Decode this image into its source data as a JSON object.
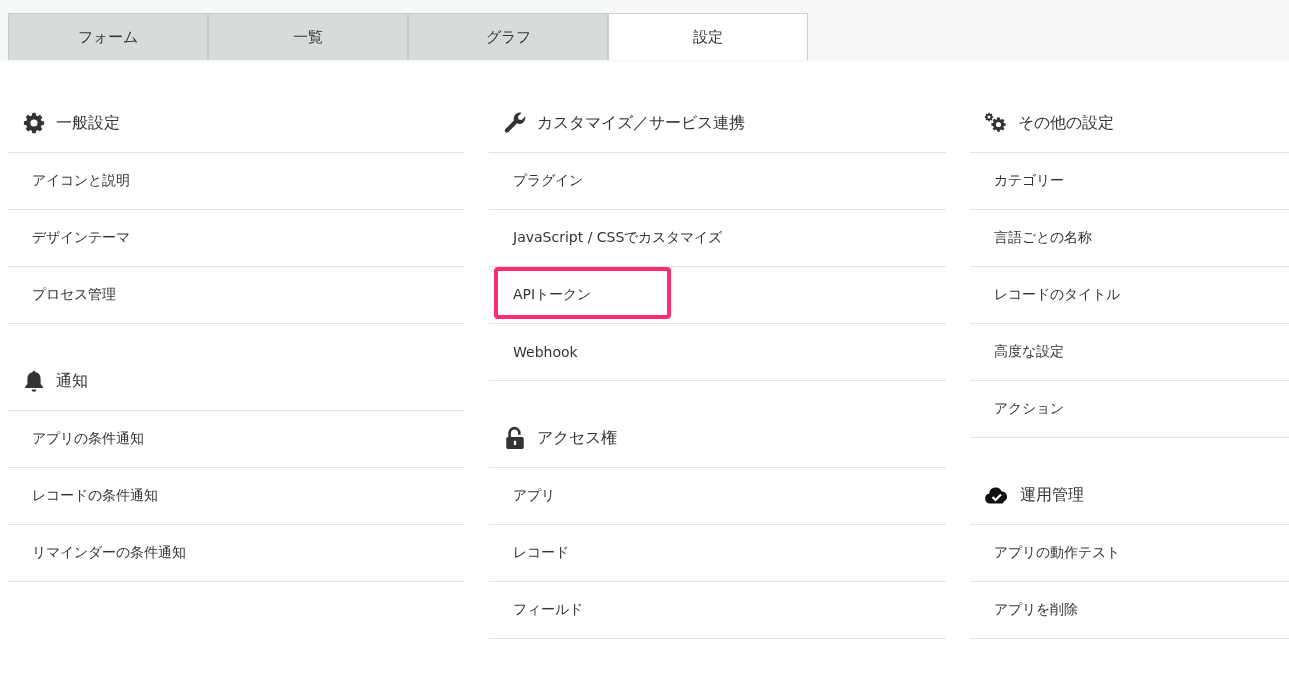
{
  "tabs": [
    {
      "label": "フォーム",
      "selected": false
    },
    {
      "label": "一覧",
      "selected": false
    },
    {
      "label": "グラフ",
      "selected": false
    },
    {
      "label": "設定",
      "selected": true
    }
  ],
  "columns": [
    {
      "sections": [
        {
          "kind": "gear",
          "title": "一般設定",
          "items": [
            {
              "label": "アイコンと説明",
              "highlighted": false
            },
            {
              "label": "デザインテーマ",
              "highlighted": false
            },
            {
              "label": "プロセス管理",
              "highlighted": false
            }
          ]
        },
        {
          "kind": "bell",
          "title": "通知",
          "items": [
            {
              "label": "アプリの条件通知",
              "highlighted": false
            },
            {
              "label": "レコードの条件通知",
              "highlighted": false
            },
            {
              "label": "リマインダーの条件通知",
              "highlighted": false
            }
          ]
        }
      ]
    },
    {
      "sections": [
        {
          "kind": "wrench",
          "title": "カスタマイズ／サービス連携",
          "items": [
            {
              "label": "プラグイン",
              "highlighted": false
            },
            {
              "label": "JavaScript / CSSでカスタマイズ",
              "highlighted": false
            },
            {
              "label": "APIトークン",
              "highlighted": true
            },
            {
              "label": "Webhook",
              "highlighted": false
            }
          ]
        },
        {
          "kind": "lock-open",
          "title": "アクセス権",
          "items": [
            {
              "label": "アプリ",
              "highlighted": false
            },
            {
              "label": "レコード",
              "highlighted": false
            },
            {
              "label": "フィールド",
              "highlighted": false
            }
          ]
        }
      ]
    },
    {
      "sections": [
        {
          "kind": "gears",
          "title": "その他の設定",
          "items": [
            {
              "label": "カテゴリー",
              "highlighted": false
            },
            {
              "label": "言語ごとの名称",
              "highlighted": false
            },
            {
              "label": "レコードのタイトル",
              "highlighted": false
            },
            {
              "label": "高度な設定",
              "highlighted": false
            },
            {
              "label": "アクション",
              "highlighted": false
            }
          ]
        },
        {
          "kind": "cloud-check",
          "title": "運用管理",
          "items": [
            {
              "label": "アプリの動作テスト",
              "highlighted": false
            },
            {
              "label": "アプリを削除",
              "highlighted": false
            }
          ]
        }
      ]
    }
  ]
}
